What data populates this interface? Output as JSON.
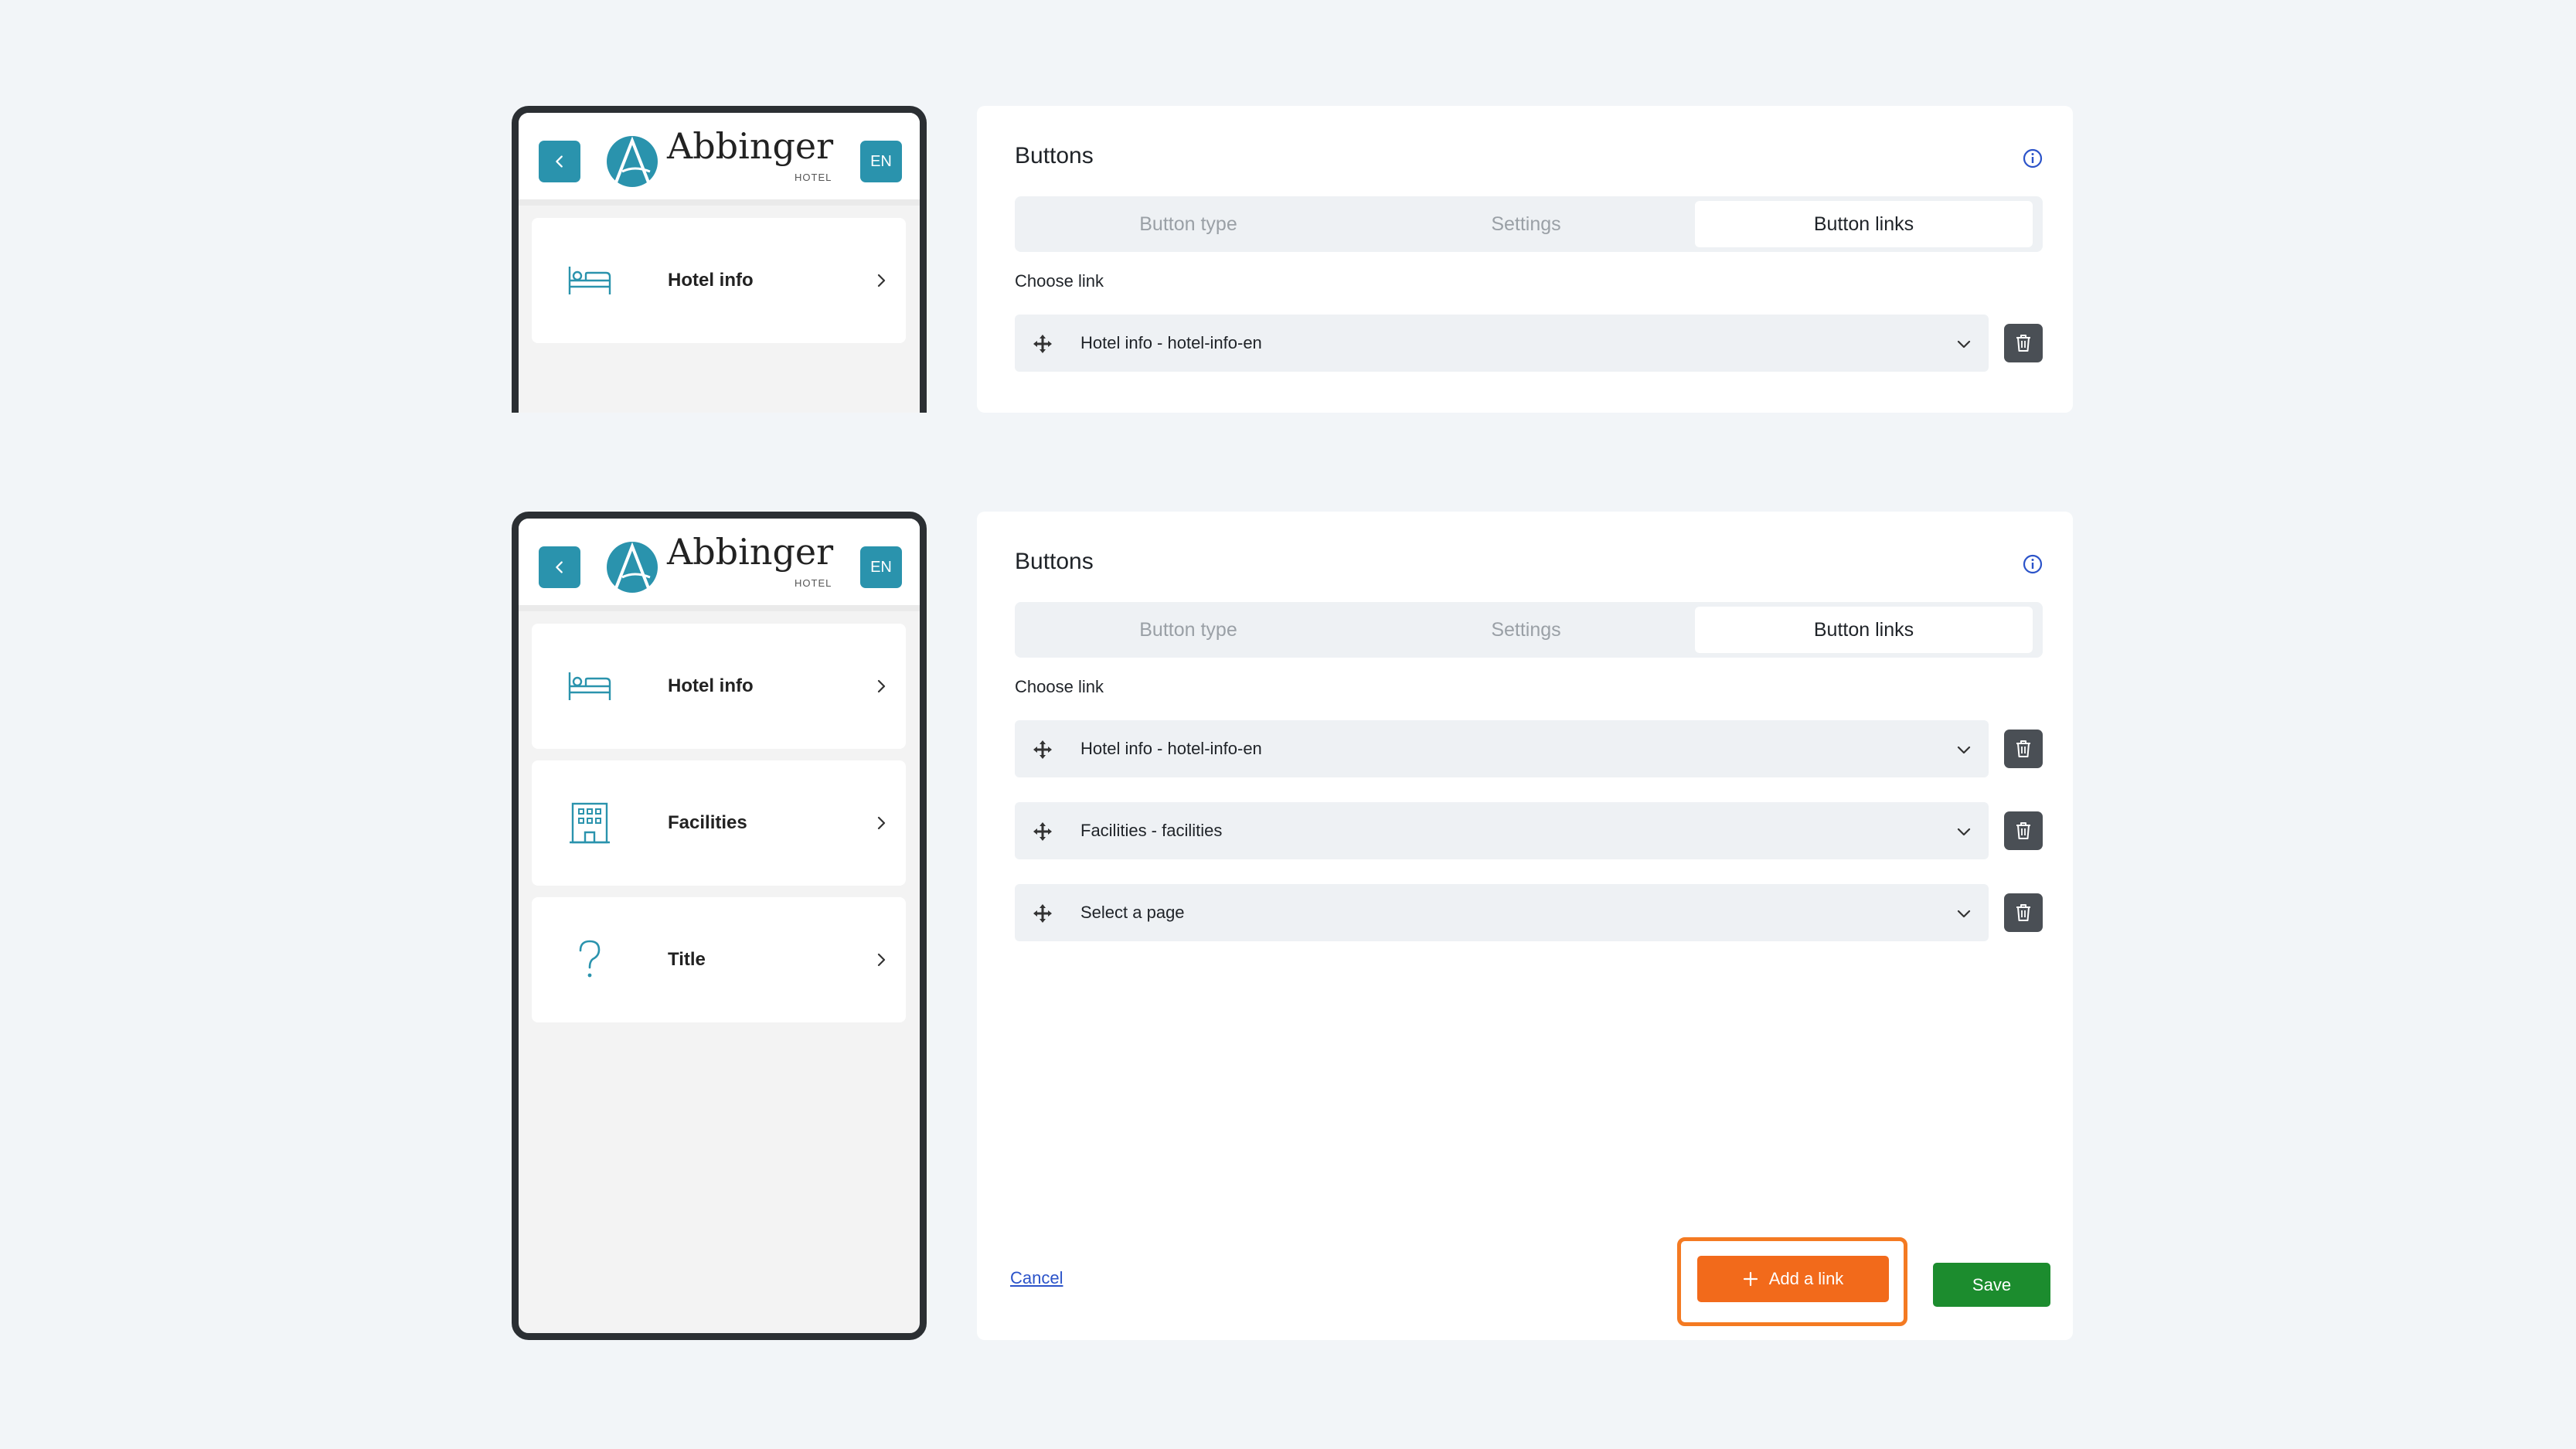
{
  "brand": {
    "name": "Abbinger",
    "sub": "HOTEL",
    "lang": "EN",
    "accent": "#2a93ad"
  },
  "top_preview": {
    "items": [
      {
        "label": "Hotel info",
        "icon": "bed-icon"
      }
    ]
  },
  "bottom_preview": {
    "items": [
      {
        "label": "Hotel info",
        "icon": "bed-icon"
      },
      {
        "label": "Facilities",
        "icon": "building-icon"
      },
      {
        "label": "Title",
        "icon": "question-icon"
      }
    ]
  },
  "top_panel": {
    "title": "Buttons",
    "tabs": [
      "Button type",
      "Settings",
      "Button links"
    ],
    "active_tab": "Button links",
    "choose_label": "Choose link",
    "links": [
      "Hotel info - hotel-info-en"
    ]
  },
  "bottom_panel": {
    "title": "Buttons",
    "tabs": [
      "Button type",
      "Settings",
      "Button links"
    ],
    "active_tab": "Button links",
    "choose_label": "Choose link",
    "links": [
      "Hotel info - hotel-info-en",
      "Facilities - facilities",
      "Select a page"
    ],
    "cancel_label": "Cancel",
    "add_label": "Add a link",
    "save_label": "Save",
    "colors": {
      "add": "#f26a1b",
      "save": "#1c8c2e",
      "highlight": "#f47a22"
    }
  }
}
